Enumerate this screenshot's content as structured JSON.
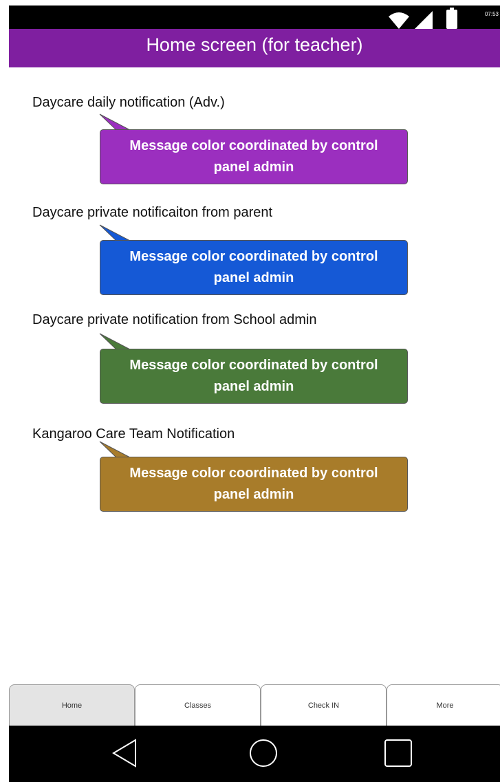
{
  "status_bar": {
    "time": "07:53",
    "icons": [
      "wifi-icon",
      "signal-icon",
      "battery-icon"
    ]
  },
  "app_bar": {
    "title": "Home screen (for teacher)",
    "color": "#7f1fa0"
  },
  "notifications": [
    {
      "label": "Daycare daily notification (Adv.)",
      "message": "Message color coordinated by control panel admin",
      "color": "#9b2fbf"
    },
    {
      "label": "Daycare private notificaiton from parent",
      "message": "Message color coordinated by control panel admin",
      "color": "#1559d6"
    },
    {
      "label": "Daycare private notification from School admin",
      "message": "Message color coordinated by control panel admin",
      "color": "#4a7a3a"
    },
    {
      "label": "Kangaroo Care Team Notification",
      "message": "Message color coordinated by control panel admin",
      "color": "#a87c2a"
    }
  ],
  "tabs": [
    {
      "label": "Home",
      "active": true
    },
    {
      "label": "Classes",
      "active": false
    },
    {
      "label": "Check IN",
      "active": false
    },
    {
      "label": "More",
      "active": false
    }
  ],
  "nav_bar": {
    "buttons": [
      "back-icon",
      "home-circle-icon",
      "recent-apps-icon"
    ]
  }
}
